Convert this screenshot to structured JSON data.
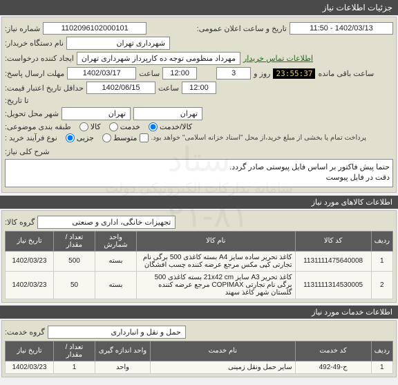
{
  "header": {
    "title": "جزئیات اطلاعات نیاز"
  },
  "info": {
    "needNo_label": "شماره نیاز:",
    "needNo": "1102096102000101",
    "announceDT_label": "تاریخ و ساعت اعلان عمومی:",
    "announceDT": "1402/03/13 - 11:50",
    "orgName_label": "نام دستگاه خریدار:",
    "orgName": "شهرداری تهران",
    "requester_label": "ایجاد کننده درخواست:",
    "requester": "مهرداد منظومی توجه ده کارپرداز شهرداری تهران",
    "contactLink": "اطلاعات تماس خریدار",
    "sendDeadline_label": "مهلت ارسال پاسخ:",
    "time_label": "ساعت",
    "sendDeadlineDate": "1402/03/17",
    "sendDeadlineTime": "12:00",
    "remainDays_label": "روز و",
    "remainDays": "3",
    "remainTime": "23:55:37",
    "remain_suffix": "ساعت باقی مانده",
    "validMin_label": "حداقل تاریخ اعتبار قیمت:",
    "validMinDate": "1402/06/15",
    "validMinTime": "12:00",
    "toDate_label": "تا تاریخ:",
    "deliveryCity_label": "شهر محل تحویل:",
    "deliveryCity1": "تهران",
    "deliveryCity2": "تهران",
    "category_label": "طبقه بندی موضوعی:",
    "cat_goods": "کالا",
    "cat_service": "خدمت",
    "cat_both": "کالا/خدمت",
    "process_label": "نوع فرآیند خرید :",
    "proc_partial": "جزیی",
    "proc_medium": "متوسط",
    "paymentNote": "پرداخت تمام یا بخشی از مبلغ خرید،از محل \"اسناد خزانه اسلامی\" خواهد بود.",
    "desc_label": "شرح کلی نیاز:",
    "desc_line1": "حتما پیش فاکتور بر اساس فایل پیوستی صادر  گردد.",
    "desc_line2": "دقت در فایل پیوست"
  },
  "goodsSection": {
    "title": "اطلاعات کالاهای مورد نیاز",
    "groupLabel": "گروه کالا:",
    "groupValue": "تجهیزات خانگی، اداری و صنعتی",
    "headers": {
      "idx": "ردیف",
      "code": "کد کالا",
      "name": "نام کالا",
      "unit": "واحد شمارش",
      "qty": "تعداد / مقدار",
      "date": "تاریخ نیاز"
    },
    "rows": [
      {
        "idx": "1",
        "code": "1131111475640008",
        "name": "کاغذ تحریر ساده سایز A4 بسته کاغذی 500 برگی نام تجارتی کپی مکس مرجع عرضه کننده چسب افشگان",
        "unit": "بسته",
        "qty": "500",
        "date": "1402/03/23"
      },
      {
        "idx": "2",
        "code": "1131111314530005",
        "name": "کاغذ تحریر A3 سایز 21x42 cm بسته کاغذی 500 برگی نام تجارتی COPIMAX مرجع عرضه کننده گلستان شهر کاغذ سهند",
        "unit": "بسته",
        "qty": "50",
        "date": "1402/03/23"
      }
    ]
  },
  "servicesSection": {
    "title": "اطلاعات خدمات مورد نیاز",
    "groupLabel": "گروه خدمت:",
    "groupValue": "حمل و نقل و انبارداری",
    "headers": {
      "idx": "ردیف",
      "code": "کد خدمت",
      "name": "نام خدمت",
      "unit": "واحد اندازه گیری",
      "qty": "تعداد / مقدار",
      "date": "تاریخ نیاز"
    },
    "rows": [
      {
        "idx": "1",
        "code": "ح-49-492",
        "name": "سایر حمل ونقل زمینی",
        "unit": "واحد",
        "qty": "1",
        "date": "1402/03/23"
      }
    ]
  },
  "watermark": {
    "line1": "ستاد",
    "line2": "سامانه تدارکات الکترونیکی دولت",
    "line3": "۰۲۱-۸۱"
  }
}
